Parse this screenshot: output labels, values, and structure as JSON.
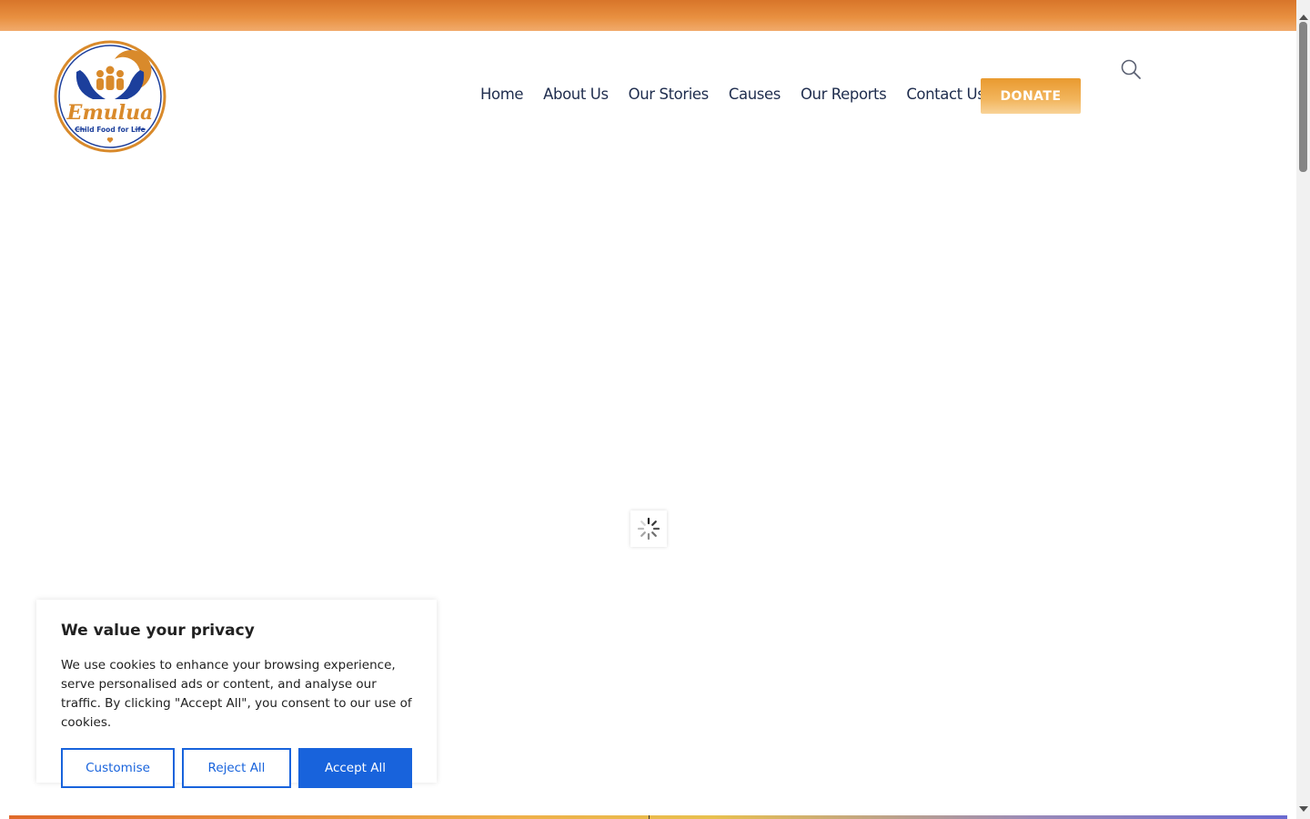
{
  "header": {
    "logo": {
      "brand_name": "Emulua",
      "tagline": "Child Food for Life",
      "icon": "logo-hands-family"
    },
    "nav": [
      {
        "label": "Home"
      },
      {
        "label": "About Us"
      },
      {
        "label": "Our Stories"
      },
      {
        "label": "Causes"
      },
      {
        "label": "Our Reports"
      },
      {
        "label": "Contact Us"
      }
    ],
    "donate_label": "DONATE",
    "search_icon": "search-icon"
  },
  "main": {
    "loader_icon": "spinner-icon"
  },
  "cookie_banner": {
    "title": "We value your privacy",
    "text": "We use cookies to enhance your browsing experience, serve personalised ads or content, and analyse our traffic. By clicking \"Accept All\", you consent to our use of cookies.",
    "customise_label": "Customise",
    "reject_label": "Reject All",
    "accept_label": "Accept All"
  },
  "colors": {
    "top_bar": "#e88f3f",
    "nav_text": "#1f2d4e",
    "donate": "#f2b55d",
    "cookie_accent": "#1863dc",
    "logo_blue": "#1c3f9c",
    "logo_orange": "#d98a2b"
  }
}
